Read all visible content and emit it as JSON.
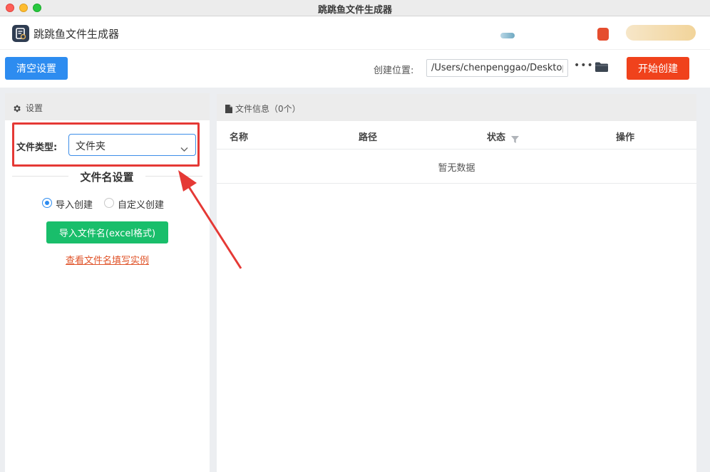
{
  "window": {
    "title": "跳跳鱼文件生成器"
  },
  "app": {
    "name": "跳跳鱼文件生成器"
  },
  "toolbar": {
    "clear_label": "清空设置",
    "location_label": "创建位置:",
    "location_value": "/Users/chenpenggao/Desktop",
    "more_label": "•••",
    "start_label": "开始创建"
  },
  "settings": {
    "title": "设置",
    "file_type_label": "文件类型:",
    "file_type_value": "文件夹",
    "filename_section_title": "文件名设置",
    "radio_import_label": "导入创建",
    "radio_custom_label": "自定义创建",
    "radio_selected": "导入创建",
    "import_button_label": "导入文件名(excel格式)",
    "example_link_label": "查看文件名填写实例"
  },
  "file_info": {
    "title": "文件信息（0个）",
    "columns": [
      "名称",
      "路径",
      "状态",
      "操作"
    ],
    "empty_text": "暂无数据"
  },
  "colors": {
    "primary_blue": "#2d8cf0",
    "start_red": "#f0421c",
    "import_green": "#19be6b",
    "annotation_red": "#e53935"
  }
}
